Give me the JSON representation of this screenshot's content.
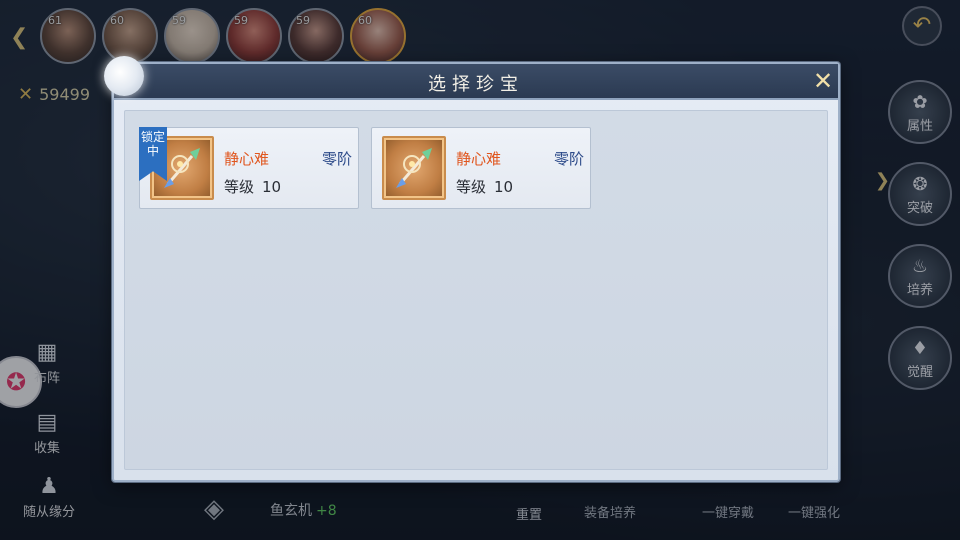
{
  "portraits": [
    {
      "level": "61"
    },
    {
      "level": "60"
    },
    {
      "level": "59"
    },
    {
      "level": "59"
    },
    {
      "level": "59"
    },
    {
      "level": "60"
    }
  ],
  "power": {
    "value": "59499"
  },
  "right_nav": [
    {
      "label": "属性",
      "icon": "emblem-icon"
    },
    {
      "label": "突破",
      "icon": "breakthrough-icon"
    },
    {
      "label": "培养",
      "icon": "cultivate-icon"
    },
    {
      "label": "觉醒",
      "icon": "awaken-icon"
    }
  ],
  "left_nav": [
    {
      "label": "布阵",
      "icon": "formation-icon"
    },
    {
      "label": "收集",
      "icon": "collect-icon"
    },
    {
      "label": "随从缘分",
      "icon": "follower-icon"
    }
  ],
  "bottom": {
    "character_name": "鱼玄机",
    "bonus": "+8",
    "center_label": "重置",
    "buttons": [
      "装备培养",
      "一键穿戴",
      "一键强化"
    ]
  },
  "modal": {
    "title": "选择珍宝",
    "items": [
      {
        "name": "静心难",
        "grade": "零阶",
        "level_label": "等级",
        "level": "10",
        "locked": true,
        "lock_text": "锁定中"
      },
      {
        "name": "静心难",
        "grade": "零阶",
        "level_label": "等级",
        "level": "10",
        "locked": false
      }
    ]
  },
  "colors": {
    "item_name": "#e0561e",
    "item_grade": "#2e4c8a",
    "lock_ribbon": "#2c6fc0",
    "modal_header": "#2b3a52"
  }
}
